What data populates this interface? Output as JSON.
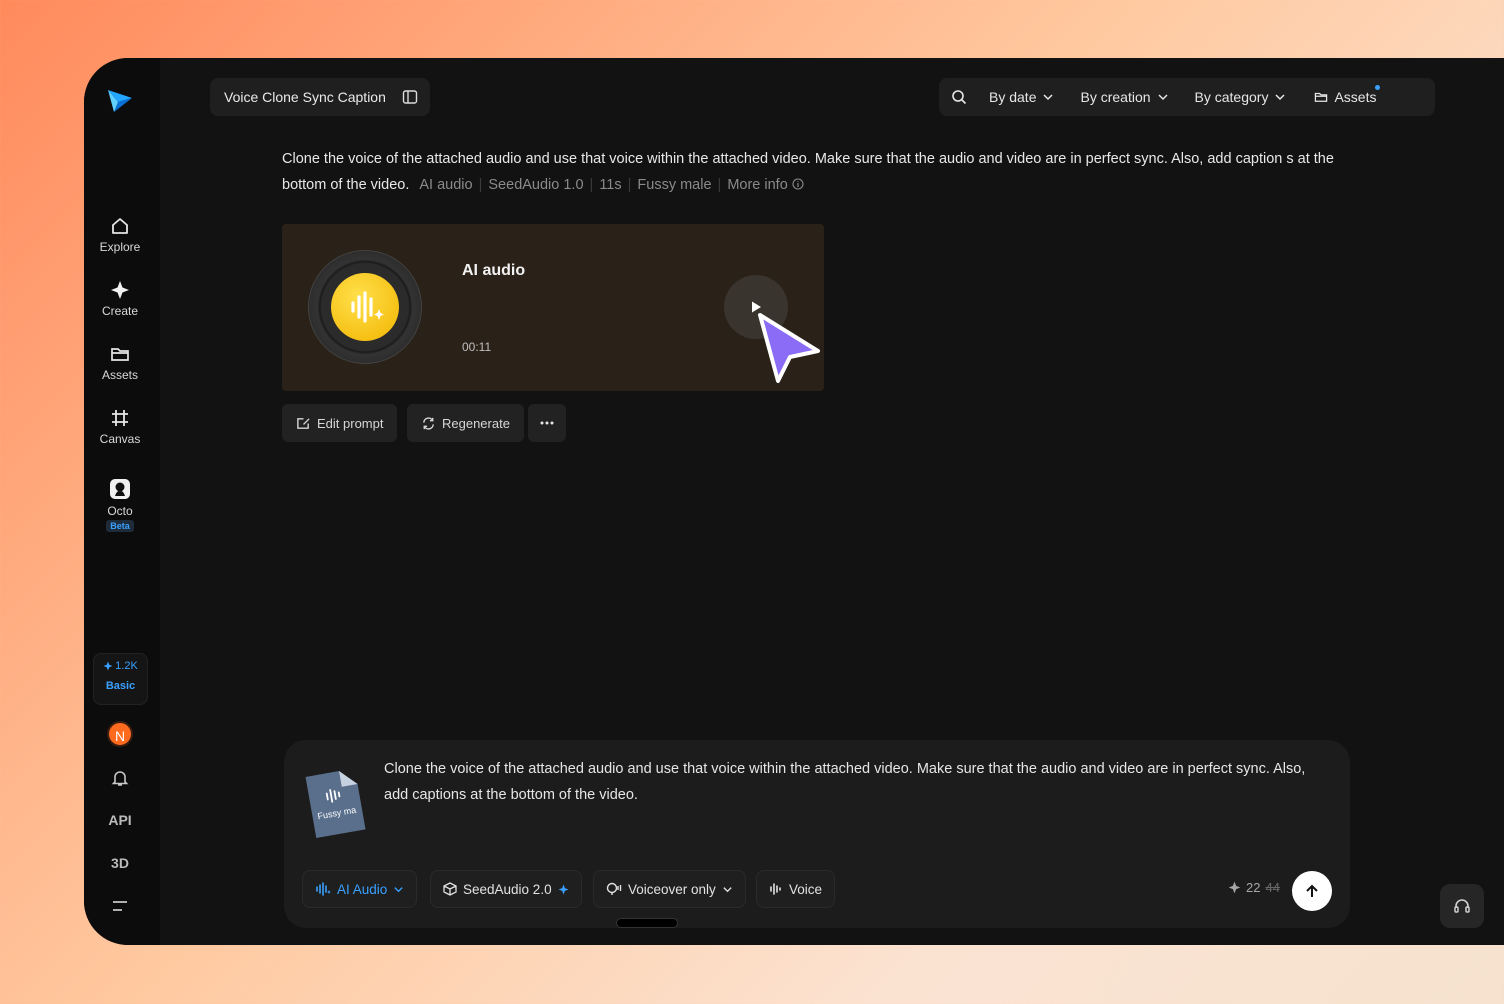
{
  "sidebar": {
    "items": [
      {
        "label": "Explore",
        "icon": "home-icon"
      },
      {
        "label": "Create",
        "icon": "sparkle-icon"
      },
      {
        "label": "Assets",
        "icon": "folder-icon"
      },
      {
        "label": "Canvas",
        "icon": "canvas-icon"
      },
      {
        "label": "Octo",
        "icon": "octo-icon",
        "badge": "Beta"
      }
    ],
    "credits": {
      "amount": "1.2K",
      "plan": "Basic"
    },
    "avatar_initial": "N",
    "api_label": "API",
    "threed_label": "3D"
  },
  "header": {
    "title": "Voice Clone Sync Caption",
    "filters": {
      "by_date": "By date",
      "by_creation": "By creation",
      "by_category": "By category",
      "assets": "Assets"
    }
  },
  "result": {
    "prompt": "Clone the voice of the attached audio and use that voice within the attached video. Make sure that the audio and video are in perfect sync. Also, add caption s at the bottom of the video.",
    "meta": [
      "AI audio",
      "SeedAudio 1.0",
      "11s",
      "Fussy male"
    ],
    "more_info": "More info",
    "card": {
      "title": "AI audio",
      "duration": "00:11"
    },
    "actions": {
      "edit": "Edit prompt",
      "regenerate": "Regenerate"
    }
  },
  "composer": {
    "file_label": "Fussy ma",
    "text": "Clone the voice of the attached audio and use that voice within the attached video. Make sure that the audio and video are in perfect sync. Also, add captions at the bottom of the video.",
    "mode": "AI Audio",
    "model": "SeedAudio 2.0",
    "voiceover": "Voiceover only",
    "voice": "Voice",
    "cost_new": "22",
    "cost_old": "44"
  },
  "colors": {
    "accent": "#3aa0ff",
    "avatar": "#ff6a1f",
    "cursor": "#8b6cf6"
  }
}
